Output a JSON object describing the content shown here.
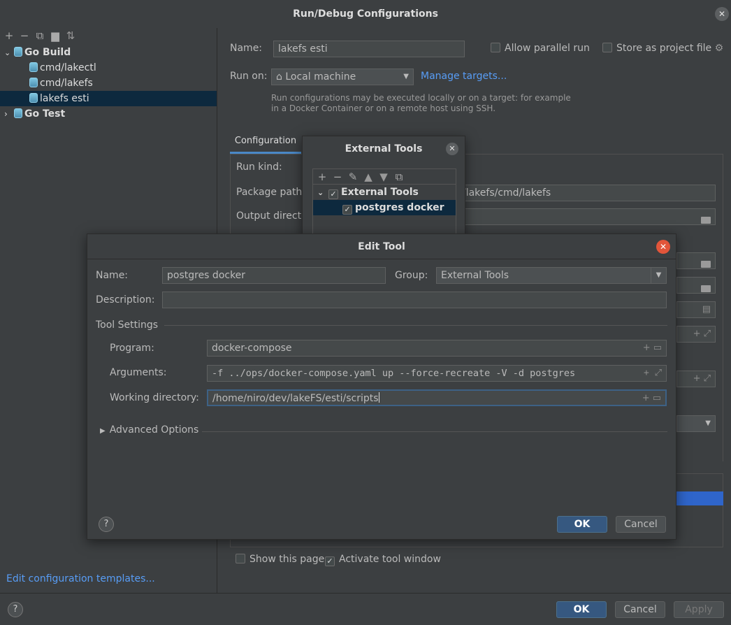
{
  "window": {
    "title": "Run/Debug Configurations"
  },
  "sidebar": {
    "groups": [
      {
        "label": "Go Build",
        "items": [
          "cmd/lakectl",
          "cmd/lakefs",
          "lakefs esti"
        ]
      },
      {
        "label": "Go Test"
      }
    ],
    "templates_link": "Edit configuration templates..."
  },
  "main": {
    "name_label": "Name:",
    "name_value": "lakefs esti",
    "allow_parallel": "Allow parallel run",
    "store_project": "Store as project file",
    "run_on_label": "Run on:",
    "run_on_value": "Local machine",
    "manage_targets": "Manage targets...",
    "hint_line1": "Run configurations may be executed locally or on a target: for example",
    "hint_line2": "in a Docker Container or on a remote host using SSH.",
    "tab_configuration": "Configuration",
    "run_kind": "Run kind:",
    "package_path": "Package path:",
    "package_path_value": "/lakefs/cmd/lakefs",
    "output_dir": "Output directo",
    "show_page": "Show this page",
    "activate_tool": "Activate tool window",
    "ok": "OK",
    "cancel": "Cancel",
    "apply": "Apply"
  },
  "external_tools": {
    "title": "External Tools",
    "group": "External Tools",
    "item": "postgres docker"
  },
  "edit_tool": {
    "title": "Edit Tool",
    "name_label": "Name:",
    "name_value": "postgres docker",
    "group_label": "Group:",
    "group_value": "External Tools",
    "description_label": "Description:",
    "description_value": "",
    "tool_settings": "Tool Settings",
    "program_label": "Program:",
    "program_value": "docker-compose",
    "arguments_label": "Arguments:",
    "arguments_value": "-f ../ops/docker-compose.yaml up --force-recreate -V -d postgres",
    "workdir_label": "Working directory:",
    "workdir_value": "/home/niro/dev/lakeFS/esti/scripts",
    "advanced": "Advanced Options",
    "help": "?",
    "ok": "OK",
    "cancel": "Cancel"
  },
  "colors": {
    "accent": "#365880",
    "link": "#589df6",
    "selection": "#0d293e",
    "close_red": "#e2553a"
  }
}
